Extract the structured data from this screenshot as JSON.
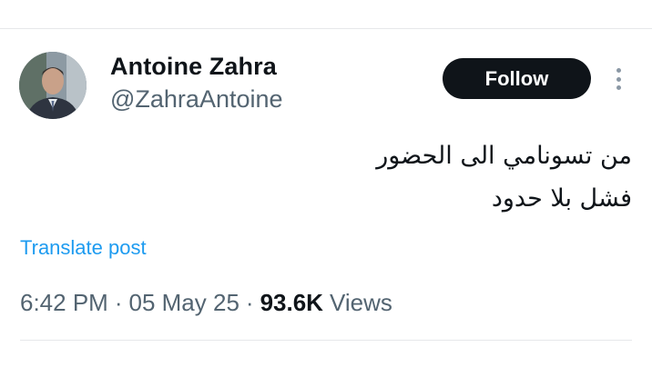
{
  "author": {
    "name": "Antoine Zahra",
    "handle": "@ZahraAntoine"
  },
  "actions": {
    "follow_label": "Follow",
    "more_icon": "more-vertical-icon"
  },
  "post": {
    "text_lines": [
      "من تسونامي الى الحضور",
      "فشل بلا حدود"
    ],
    "translate_label": "Translate post"
  },
  "meta": {
    "time": "6:42 PM",
    "separator": "·",
    "date": "05 May 25",
    "views_count": "93.6K",
    "views_label": "Views"
  },
  "colors": {
    "text_primary": "#0f1419",
    "text_secondary": "#536471",
    "link": "#1d9bf0",
    "follow_button_bg": "#0f1419",
    "follow_button_text": "#ffffff",
    "divider": "#e6e8ea"
  }
}
